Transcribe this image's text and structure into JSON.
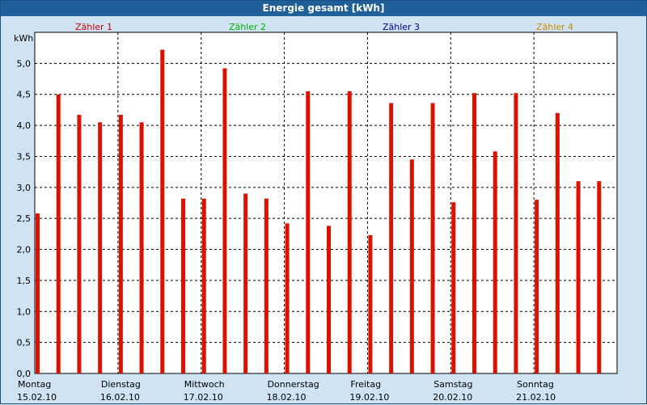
{
  "window": {
    "title": "Energie gesamt [kWh]"
  },
  "chart_data": {
    "type": "bar",
    "ylabel": "kWh",
    "ylim": [
      0,
      5.5
    ],
    "yticks": [
      "0,0",
      "0,5",
      "1,0",
      "1,5",
      "2,0",
      "2,5",
      "3,0",
      "3,5",
      "4,0",
      "4,5",
      "5,0"
    ],
    "grid": true,
    "bar_color": "#dd1100",
    "legend_position": "top",
    "days": [
      {
        "name": "Montag",
        "date": "15.02.10"
      },
      {
        "name": "Dienstag",
        "date": "16.02.10"
      },
      {
        "name": "Mittwoch",
        "date": "17.02.10"
      },
      {
        "name": "Donnerstag",
        "date": "18.02.10"
      },
      {
        "name": "Freitag",
        "date": "19.02.10"
      },
      {
        "name": "Samstag",
        "date": "20.02.10"
      },
      {
        "name": "Sonntag",
        "date": "21.02.10"
      }
    ],
    "series": [
      {
        "name": "Zähler 1",
        "color": "#cc0000",
        "values": [
          2.58,
          4.17,
          2.82,
          2.42,
          2.23,
          2.76,
          2.8
        ]
      },
      {
        "name": "Zähler 2",
        "color": "#00b000",
        "values": [
          4.5,
          4.05,
          4.92,
          4.55,
          4.36,
          4.52,
          4.2
        ]
      },
      {
        "name": "Zähler 3",
        "color": "#0000a0",
        "values": [
          4.17,
          5.22,
          2.9,
          2.38,
          3.45,
          3.58,
          3.1
        ]
      },
      {
        "name": "Zähler 4",
        "color": "#cc8800",
        "values": [
          4.05,
          2.82,
          2.82,
          4.55,
          4.36,
          4.52,
          3.1
        ]
      }
    ]
  }
}
